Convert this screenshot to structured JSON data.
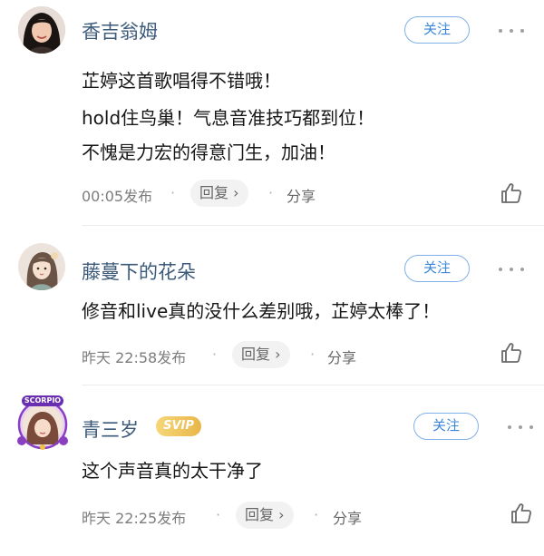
{
  "comments": [
    {
      "user": "香吉翁姆",
      "follow_label": "关注",
      "lines": [
        "芷婷这首歌唱得不错哦！",
        "hold住鸟巢！气息音准技巧都到位！",
        "不愧是力宏的得意门生，加油！"
      ],
      "time": "00:05发布",
      "reply_label": "回复",
      "reply_chevron": "›",
      "share_label": "分享",
      "avatar_icon": "user-avatar-photo",
      "like_icon": "thumbs-up-icon"
    },
    {
      "user": "藤蔓下的花朵",
      "follow_label": "关注",
      "lines": [
        "修音和live真的没什么差别哦，芷婷太棒了！"
      ],
      "time": "昨天 22:58发布",
      "reply_label": "回复",
      "reply_chevron": "›",
      "share_label": "分享",
      "avatar_icon": "user-avatar-illustration",
      "like_icon": "thumbs-up-icon"
    },
    {
      "user": "青三岁",
      "badge": "SVIP",
      "avatar_frame_text": "SCORPIO",
      "follow_label": "关注",
      "lines": [
        "这个声音真的太干净了"
      ],
      "time": "昨天 22:25发布",
      "reply_label": "回复",
      "reply_chevron": "›",
      "share_label": "分享",
      "avatar_icon": "user-avatar-scorpio-frame",
      "like_icon": "thumbs-up-icon"
    }
  ],
  "separator": "·",
  "colors": {
    "username": "#3c5a7a",
    "follow_border": "#7fb1e8",
    "follow_text": "#3a86d8",
    "meta": "#7d7d7d",
    "svip_gold": "#e8b64a"
  }
}
